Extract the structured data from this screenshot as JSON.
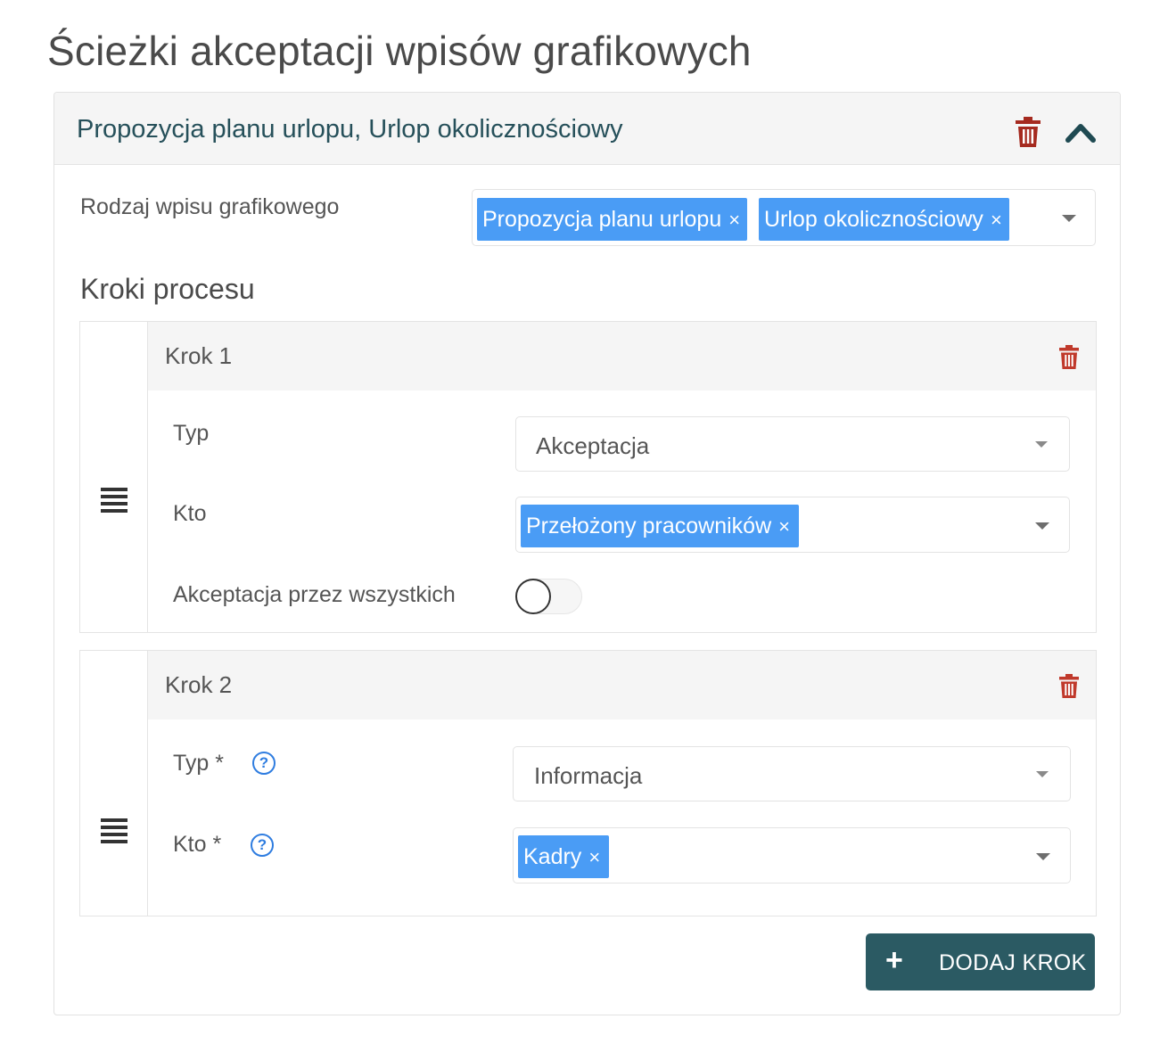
{
  "page": {
    "title": "Ścieżki akceptacji wpisów grafikowych"
  },
  "path": {
    "header_title": "Propozycja planu urlopu, Urlop okolicznościowy",
    "entry_type_label": "Rodzaj wpisu grafikowego",
    "entry_types": [
      {
        "label": "Propozycja planu urlopu",
        "remove": "×"
      },
      {
        "label": "Urlop okolicznościowy",
        "remove": "×"
      }
    ],
    "steps_section_title": "Kroki procesu",
    "steps": [
      {
        "title": "Krok 1",
        "type_label": "Typ",
        "type_value": "Akceptacja",
        "who_label": "Kto",
        "who_tags": [
          {
            "label": "Przełożony pracowników",
            "remove": "×"
          }
        ],
        "all_accept_label": "Akceptacja przez wszystkich",
        "all_accept_enabled": false
      },
      {
        "title": "Krok 2",
        "type_label": "Typ *",
        "type_value": "Informacja",
        "who_label": "Kto *",
        "who_tags": [
          {
            "label": "Kadry",
            "remove": "×"
          }
        ],
        "help_icon": "?"
      }
    ],
    "add_step_label": "DODAJ KROK",
    "add_step_icon": "+"
  },
  "colors": {
    "accent_dark": "#2b5a63",
    "tag_blue": "#4a9cf5",
    "danger": "#a52a1f",
    "help_blue": "#2f7de0"
  }
}
